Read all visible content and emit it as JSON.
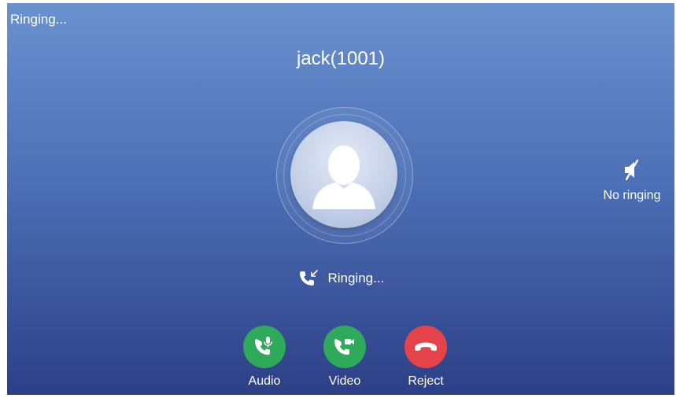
{
  "status": {
    "top_text": "Ringing...",
    "call_state": "Ringing..."
  },
  "caller": {
    "display": "jack(1001)"
  },
  "side_action": {
    "label": "No ringing",
    "icon": "speaker-muted-icon"
  },
  "actions": [
    {
      "label": "Audio",
      "icon": "phone-mic-icon",
      "color": "#2eaa5a"
    },
    {
      "label": "Video",
      "icon": "phone-video-icon",
      "color": "#2eaa5a"
    },
    {
      "label": "Reject",
      "icon": "hang-up-icon",
      "color": "#e4434a"
    }
  ],
  "colors": {
    "background_top": "#6a91cf",
    "background_bottom": "#2c3f86",
    "accept": "#2eaa5a",
    "reject": "#e4434a"
  }
}
